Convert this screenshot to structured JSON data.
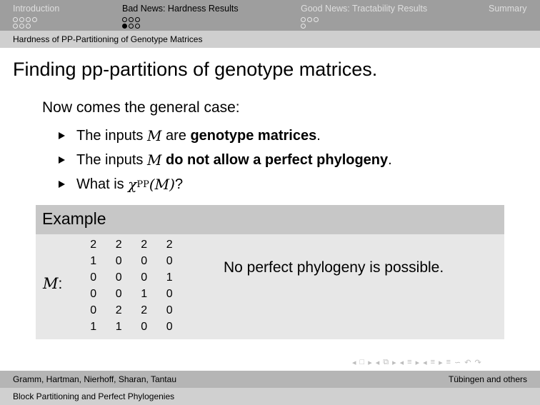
{
  "nav": {
    "sections": [
      {
        "label": "Introduction",
        "current": false,
        "dot_rows": [
          4,
          3
        ],
        "filled": []
      },
      {
        "label": "Bad News: Hardness Results",
        "current": true,
        "dot_rows": [
          3,
          3
        ],
        "filled": [
          [
            1,
            0
          ]
        ]
      },
      {
        "label": "Good News: Tractability Results",
        "current": false,
        "dot_rows": [
          3,
          1
        ],
        "filled": []
      },
      {
        "label": "Summary",
        "current": false,
        "dot_rows": [],
        "filled": []
      }
    ],
    "subsection": "Hardness of PP-Partitioning of Genotype Matrices"
  },
  "frame": {
    "title": "Finding pp-partitions of genotype matrices.",
    "intro": "Now comes the general case:",
    "bullet1": {
      "pre": "The inputs ",
      "math": "M",
      "mid": " are ",
      "bold": "genotype matrices",
      "post": "."
    },
    "bullet2": {
      "pre": "The inputs ",
      "math": "M",
      "mid": " ",
      "bold": "do not allow a perfect phylogeny",
      "post": "."
    },
    "bullet3": {
      "pre": "What is ",
      "chi": "χ",
      "sub": "PP",
      "arg": "(M)",
      "post": "?"
    }
  },
  "example": {
    "title": "Example",
    "matrix_label": "M",
    "colon": ":",
    "matrix": [
      [
        "2",
        "2",
        "2",
        "2"
      ],
      [
        "1",
        "0",
        "0",
        "0"
      ],
      [
        "0",
        "0",
        "0",
        "1"
      ],
      [
        "0",
        "0",
        "1",
        "0"
      ],
      [
        "0",
        "2",
        "2",
        "0"
      ],
      [
        "1",
        "1",
        "0",
        "0"
      ]
    ],
    "statement": "No perfect phylogeny is possible."
  },
  "navsymbols": [
    "◂",
    "□",
    "▸",
    "◂",
    "⧉",
    "▸",
    "◂",
    "≡",
    "▸",
    "◂",
    "≡",
    "▸",
    "≡",
    "∽",
    "↶",
    "↷"
  ],
  "footer": {
    "authors": "Gramm, Hartman, Nierhoff, Sharan, Tantau",
    "institute": "Tübingen and others",
    "talk_title": "Block Partitioning and Perfect Phylogenies"
  },
  "colors": {
    "nav_bg": "#9e9e9e",
    "subbar_bg": "#cfcfcf",
    "block_head": "#c7c7c7",
    "block_body": "#e7e7e7"
  }
}
